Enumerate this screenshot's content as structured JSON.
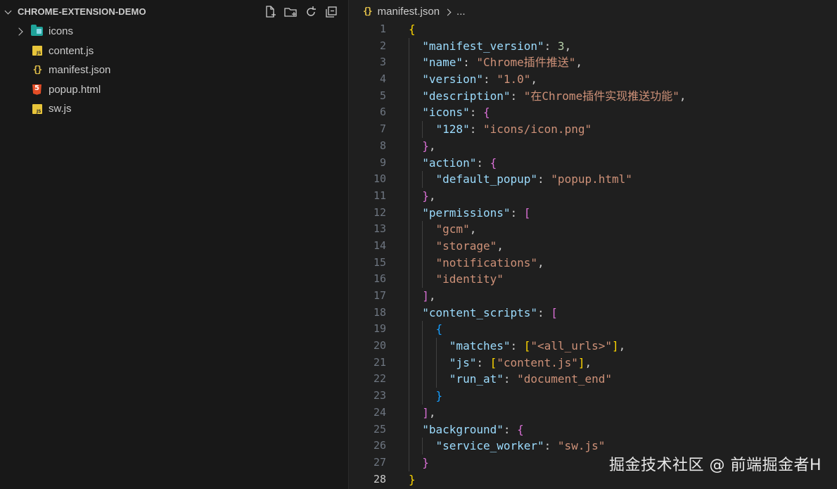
{
  "explorer": {
    "title": "CHROME-EXTENSION-DEMO",
    "actions": [
      "new-file-icon",
      "new-folder-icon",
      "refresh-icon",
      "collapse-all-icon"
    ],
    "items": [
      {
        "label": "icons",
        "type": "folder"
      },
      {
        "label": "content.js",
        "type": "js"
      },
      {
        "label": "manifest.json",
        "type": "json"
      },
      {
        "label": "popup.html",
        "type": "html"
      },
      {
        "label": "sw.js",
        "type": "js"
      }
    ]
  },
  "breadcrumb": {
    "file": "manifest.json",
    "ellipsis": "..."
  },
  "editor": {
    "active_line": "28",
    "lines": [
      {
        "n": "1",
        "t": "{"
      },
      {
        "n": "2",
        "t": "  \"manifest_version\": 3,"
      },
      {
        "n": "3",
        "t": "  \"name\": \"Chrome插件推送\","
      },
      {
        "n": "4",
        "t": "  \"version\": \"1.0\","
      },
      {
        "n": "5",
        "t": "  \"description\": \"在Chrome插件实现推送功能\","
      },
      {
        "n": "6",
        "t": "  \"icons\": {"
      },
      {
        "n": "7",
        "t": "    \"128\": \"icons/icon.png\""
      },
      {
        "n": "8",
        "t": "  },"
      },
      {
        "n": "9",
        "t": "  \"action\": {"
      },
      {
        "n": "10",
        "t": "    \"default_popup\": \"popup.html\""
      },
      {
        "n": "11",
        "t": "  },"
      },
      {
        "n": "12",
        "t": "  \"permissions\": ["
      },
      {
        "n": "13",
        "t": "    \"gcm\","
      },
      {
        "n": "14",
        "t": "    \"storage\","
      },
      {
        "n": "15",
        "t": "    \"notifications\","
      },
      {
        "n": "16",
        "t": "    \"identity\""
      },
      {
        "n": "17",
        "t": "  ],"
      },
      {
        "n": "18",
        "t": "  \"content_scripts\": ["
      },
      {
        "n": "19",
        "t": "    {"
      },
      {
        "n": "20",
        "t": "      \"matches\": [\"<all_urls>\"],"
      },
      {
        "n": "21",
        "t": "      \"js\": [\"content.js\"],"
      },
      {
        "n": "22",
        "t": "      \"run_at\": \"document_end\""
      },
      {
        "n": "23",
        "t": "    }"
      },
      {
        "n": "24",
        "t": "  ],"
      },
      {
        "n": "25",
        "t": "  \"background\": {"
      },
      {
        "n": "26",
        "t": "    \"service_worker\": \"sw.js\""
      },
      {
        "n": "27",
        "t": "  }"
      },
      {
        "n": "28",
        "t": "}"
      }
    ]
  },
  "watermark": "掘金技术社区 @ 前端掘金者H",
  "colors": {
    "key": "#9cdcfe",
    "string": "#ce9178",
    "number": "#b5cea8",
    "bracket_level1": "#ffd700",
    "bracket_level2": "#da70d6",
    "bracket_level3": "#179fff"
  }
}
